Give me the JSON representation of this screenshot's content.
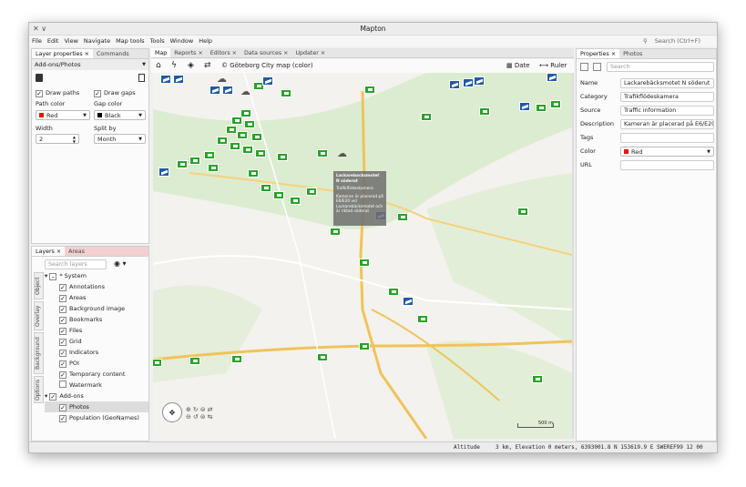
{
  "window": {
    "title": "Mapton"
  },
  "menu": [
    "File",
    "Edit",
    "View",
    "Navigate",
    "Map tools",
    "Tools",
    "Window",
    "Help"
  ],
  "search": {
    "placeholder": "Search (Ctrl+F)"
  },
  "left_top": {
    "tabs": [
      "Layer properties ×",
      "Commands"
    ],
    "selector": "Add-ons/Photos",
    "draw_paths": "Draw paths",
    "draw_gaps": "Draw gaps",
    "path_color_label": "Path color",
    "gap_color_label": "Gap color",
    "path_color": "Red",
    "gap_color": "Black",
    "width_label": "Width",
    "split_label": "Split by",
    "width_value": "2",
    "split_value": "Month",
    "colors": {
      "red": "#e11",
      "black": "#000"
    }
  },
  "layers": {
    "tabs": [
      "Layers ×",
      "Areas"
    ],
    "search_placeholder": "Search layers",
    "vtabs": [
      "Object",
      "Overlay",
      "Background",
      "Options"
    ],
    "items": [
      {
        "label": "* System",
        "indent": 0
      },
      {
        "label": "Annotations",
        "indent": 1
      },
      {
        "label": "Areas",
        "indent": 1
      },
      {
        "label": "Background image",
        "indent": 1
      },
      {
        "label": "Bookmarks",
        "indent": 1
      },
      {
        "label": "Files",
        "indent": 1
      },
      {
        "label": "Grid",
        "indent": 1
      },
      {
        "label": "Indicators",
        "indent": 1
      },
      {
        "label": "POI",
        "indent": 1
      },
      {
        "label": "Temporary content",
        "indent": 1
      },
      {
        "label": "Watermark",
        "indent": 1
      },
      {
        "label": "Add-ons",
        "indent": 0
      },
      {
        "label": "Photos",
        "indent": 1
      },
      {
        "label": "Population (GeoNames)",
        "indent": 1
      }
    ]
  },
  "center": {
    "tabs": [
      "Map",
      "Reports ×",
      "Editors ×",
      "Data sources ×",
      "Updater ×"
    ],
    "map_name": "Göteborg City map (color)",
    "date_label": "Date",
    "ruler_label": "Ruler"
  },
  "popup": {
    "title": "Lackarebacksmotet N söderut",
    "category": "Trafikflödeskamera",
    "desc": "Kameran är placerad på E6/E20 vid Lackarebäcksmotet och är riktad söderut"
  },
  "props": {
    "tabs": [
      "Properties ×",
      "Photos"
    ],
    "search_placeholder": "Search",
    "rows": [
      {
        "k": "Name",
        "v": "Lackarebäcksmotet N söderut"
      },
      {
        "k": "Category",
        "v": "Trafikflödeskamera"
      },
      {
        "k": "Source",
        "v": "Traffic information"
      },
      {
        "k": "Description",
        "v": "Kameran är placerad på E6/E20"
      },
      {
        "k": "Tags",
        "v": ""
      },
      {
        "k": "Color",
        "v": "Red"
      },
      {
        "k": "URL",
        "v": ""
      }
    ]
  },
  "status": {
    "altitude": "Altitude",
    "text": "3 km, Elevation    0 meters, 6393001.8 N  153619.9 E  SWEREF99 12 00"
  },
  "scale": "500 m"
}
